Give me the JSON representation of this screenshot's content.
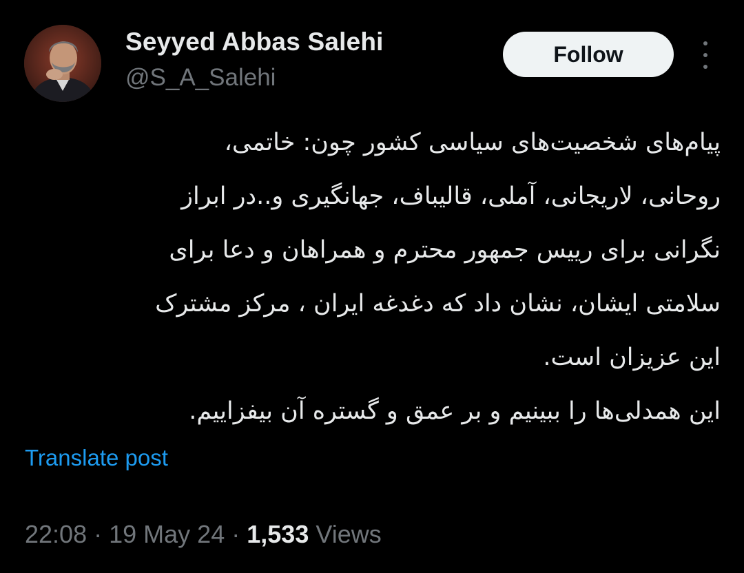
{
  "author": {
    "name": "Seyyed Abbas Salehi",
    "handle": "@S_A_Salehi"
  },
  "follow_label": "Follow",
  "post": {
    "lines": [
      "پیام‌های شخصیت‌های سیاسی کشور چون: خاتمی،",
      "روحانی، لاریجانی، آملی، قالیباف، جهانگیری و..در ابراز",
      "نگرانی برای رییس جمهور محترم و همراهان و دعا برای",
      "سلامتی ایشان، نشان داد که دغدغه ایران ، مرکز مشترک",
      "این عزیزان است.",
      "این همدلی‌ها را ببینیم و بر عمق و گستره آن بیفزاییم."
    ]
  },
  "translate_label": "Translate post",
  "meta": {
    "time": "22:08",
    "separator": "·",
    "date": "19 May 24",
    "views_count": "1,533",
    "views_label": "Views"
  },
  "colors": {
    "background": "#000000",
    "text": "#e7e9ea",
    "secondary": "#71767b",
    "link": "#1d9bf0",
    "button_bg": "#eff3f4"
  },
  "icons": {
    "more": "more-vertical-icon",
    "avatar": "profile-photo"
  }
}
